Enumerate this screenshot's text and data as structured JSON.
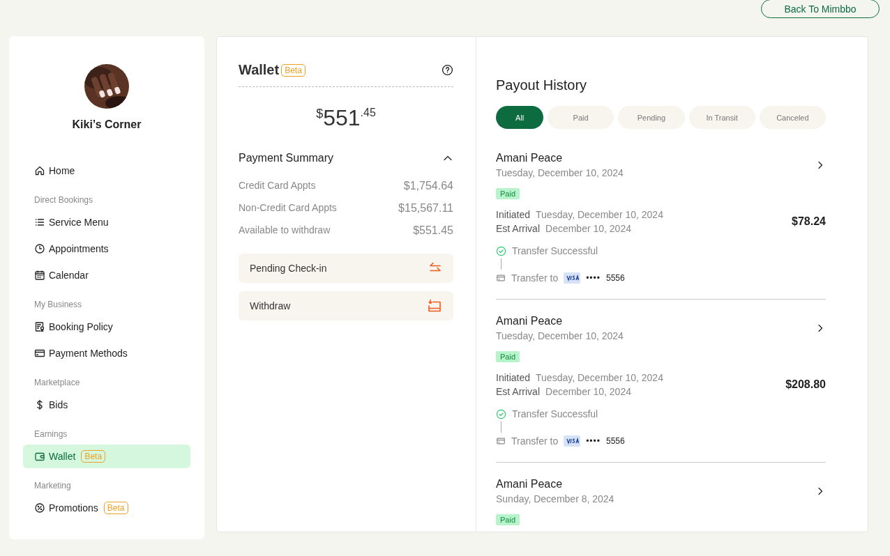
{
  "header": {
    "back_button": "Back To Mimbbo"
  },
  "sidebar": {
    "profile": {
      "name": "Kiki’s Corner"
    },
    "items": [
      {
        "kind": "link",
        "label": "Home",
        "selected": false
      },
      {
        "kind": "heading",
        "label": "Direct Bookings"
      },
      {
        "kind": "link",
        "label": "Service Menu",
        "selected": false
      },
      {
        "kind": "link",
        "label": "Appointments",
        "selected": false
      },
      {
        "kind": "link",
        "label": "Calendar",
        "selected": false
      },
      {
        "kind": "heading",
        "label": "My Business"
      },
      {
        "kind": "link",
        "label": "Booking Policy",
        "selected": false
      },
      {
        "kind": "link",
        "label": "Payment Methods",
        "selected": false
      },
      {
        "kind": "heading",
        "label": "Marketplace"
      },
      {
        "kind": "link",
        "label": "Bids",
        "selected": false
      },
      {
        "kind": "heading",
        "label": "Earnings"
      },
      {
        "kind": "link",
        "label": "Wallet",
        "badge": "Beta",
        "selected": true
      },
      {
        "kind": "heading",
        "label": "Marketing"
      },
      {
        "kind": "link",
        "label": "Promotions",
        "badge": "Beta",
        "selected": false
      }
    ]
  },
  "wallet": {
    "title": "Wallet",
    "badge": "Beta",
    "balance": {
      "currency": "$",
      "whole": "551",
      "cents": ".45"
    },
    "summary": {
      "title": "Payment Summary",
      "expanded": true,
      "rows": [
        {
          "label": "Credit Card Appts",
          "value": "$1,754.64"
        },
        {
          "label": "Non-Credit Card Appts",
          "value": "$15,567.11"
        },
        {
          "label": "Available to withdraw",
          "value": "$551.45"
        }
      ]
    },
    "actions": [
      {
        "label": "Pending Check-in"
      },
      {
        "label": "Withdraw"
      }
    ]
  },
  "payouts": {
    "title": "Payout History",
    "filters": [
      {
        "label": "All",
        "selected": true
      },
      {
        "label": "Paid",
        "selected": false
      },
      {
        "label": "Pending",
        "selected": false
      },
      {
        "label": "In Transit",
        "selected": false
      },
      {
        "label": "Canceled",
        "selected": false
      }
    ],
    "items": [
      {
        "name": "Amani Peace",
        "date": "Tuesday, December 10, 2024",
        "status": "Paid",
        "initiated_label": "Initiated",
        "initiated": "Tuesday, December 10, 2024",
        "arrival_label": "Est Arrival",
        "arrival": "December 10, 2024",
        "amount": "$78.24",
        "step": "Transfer Successful",
        "transfer_label": "Transfer to",
        "mask": "••••",
        "last4": "5556"
      },
      {
        "name": "Amani Peace",
        "date": "Tuesday, December 10, 2024",
        "status": "Paid",
        "initiated_label": "Initiated",
        "initiated": "Tuesday, December 10, 2024",
        "arrival_label": "Est Arrival",
        "arrival": "December 10, 2024",
        "amount": "$208.80",
        "step": "Transfer Successful",
        "transfer_label": "Transfer to",
        "mask": "••••",
        "last4": "5556"
      },
      {
        "name": "Amani Peace",
        "date": "Sunday, December 8, 2024",
        "status": "Paid"
      }
    ]
  }
}
